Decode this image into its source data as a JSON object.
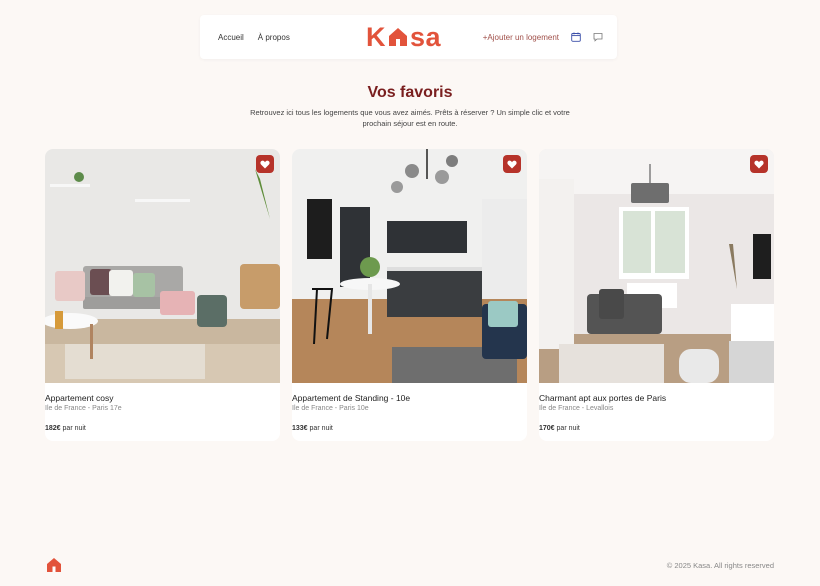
{
  "header": {
    "nav_left": [
      "Accueil",
      "À propos"
    ],
    "logo_left": "K",
    "logo_right": "sa",
    "add_listing": "+Ajouter un logement",
    "brand_color": "#e2533b"
  },
  "page": {
    "title": "Vos favoris",
    "subtitle": "Retrouvez ici tous les logements que vous avez aimés. Prêts à réserver ? Un simple clic et votre prochain séjour est en route."
  },
  "cards": [
    {
      "title": "Appartement cosy",
      "location": "Ile de France - Paris 17e",
      "price": "182€",
      "price_suffix": "par nuit"
    },
    {
      "title": "Appartement de Standing - 10e",
      "location": "Ile de France - Paris 10e",
      "price": "133€",
      "price_suffix": "par nuit"
    },
    {
      "title": "Charmant apt aux portes de Paris",
      "location": "Ile de France - Levallois",
      "price": "170€",
      "price_suffix": "par nuit"
    }
  ],
  "footer": {
    "copyright": "© 2025 Kasa. All rights reserved"
  },
  "colors": {
    "background": "#fcf8f5",
    "favorite": "#b6332a",
    "title": "#7a1f1f"
  }
}
